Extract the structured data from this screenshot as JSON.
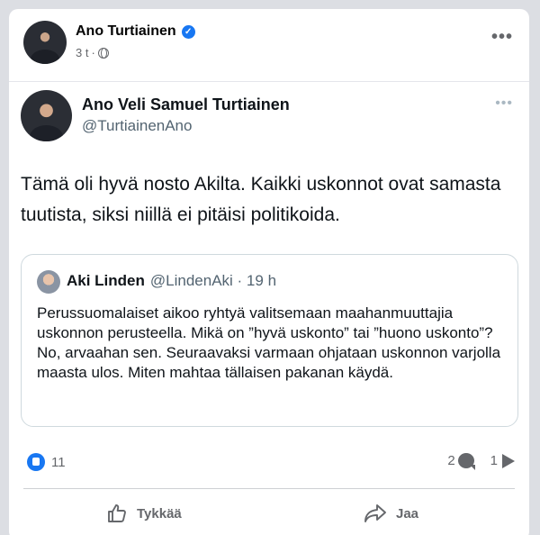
{
  "post": {
    "author": "Ano Turtiainen",
    "time": "3 t",
    "separator": "·",
    "more": "•••"
  },
  "tweet": {
    "name": "Ano Veli Samuel Turtiainen",
    "handle": "@TurtiainenAno",
    "more": "•••",
    "text": "Tämä oli hyvä nosto Akilta. Kaikki uskonnot ovat samasta tuutista, siksi niillä ei pitäisi politikoida.",
    "quote": {
      "name": "Aki Linden",
      "handle": "@LindenAki · 19 h",
      "text": "Perussuomalaiset aikoo ryhtyä valitsemaan maahanmuuttajia uskonnon perusteella. Mikä on ”hyvä uskonto” tai ”huono uskonto”? No, arvaahan sen. Seuraavaksi varmaan ohjataan uskonnon varjolla maasta ulos. Miten mahtaa tällaisen pakanan käydä."
    }
  },
  "stats": {
    "likes": "11",
    "comments": "2",
    "shares": "1"
  },
  "actions": {
    "like": "Tykkää",
    "share": "Jaa"
  },
  "colors": {
    "accent": "#1877f2",
    "muted": "#65676b"
  }
}
